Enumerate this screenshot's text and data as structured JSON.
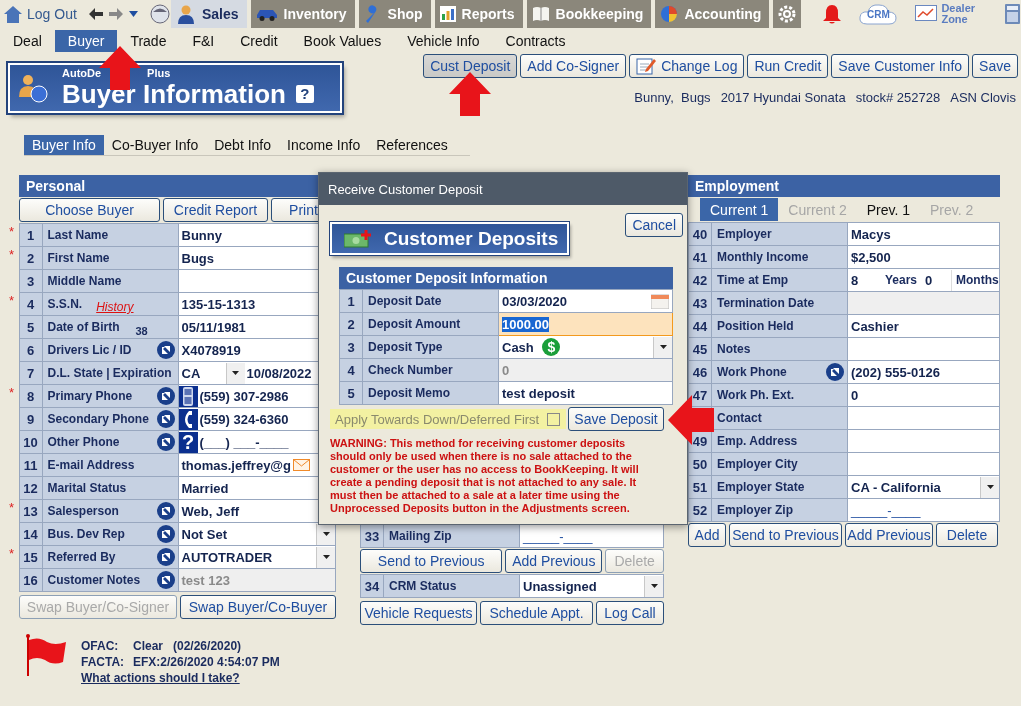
{
  "top_nav": {
    "logout": "Log Out",
    "modules": [
      {
        "label": "Sales",
        "selected": true
      },
      {
        "label": "Inventory",
        "selected": false
      },
      {
        "label": "Shop",
        "selected": false
      },
      {
        "label": "Reports",
        "selected": false
      },
      {
        "label": "Bookkeeping",
        "selected": false
      },
      {
        "label": "Accounting",
        "selected": false
      }
    ],
    "crm": "CRM",
    "dealer_zone": "Dealer Zone"
  },
  "menu": [
    {
      "label": "Deal",
      "selected": false
    },
    {
      "label": "Buyer",
      "selected": true
    },
    {
      "label": "Trade",
      "selected": false
    },
    {
      "label": "F&I",
      "selected": false
    },
    {
      "label": "Credit",
      "selected": false
    },
    {
      "label": "Book Values",
      "selected": false
    },
    {
      "label": "Vehicle Info",
      "selected": false
    },
    {
      "label": "Contracts",
      "selected": false
    }
  ],
  "header": {
    "brand_parts": [
      "AutoDe",
      "Plus"
    ],
    "title": "Buyer Information",
    "help": "?"
  },
  "actions": [
    {
      "label": "Cust Deposit",
      "pressed": true
    },
    {
      "label": "Add Co-Signer",
      "pressed": false
    },
    {
      "label": "Change Log",
      "pressed": false
    },
    {
      "label": "Run Credit",
      "pressed": false
    },
    {
      "label": "Save Customer Info",
      "pressed": false
    },
    {
      "label": "Save",
      "pressed": false
    }
  ],
  "customer_line": [
    "Bunny,  Bugs",
    "2017 Hyundai Sonata",
    "stock# 252728",
    "ASN Clovis"
  ],
  "subtabs": [
    {
      "label": "Buyer Info",
      "selected": true
    },
    {
      "label": "Co-Buyer Info",
      "selected": false
    },
    {
      "label": "Debt Info",
      "selected": false
    },
    {
      "label": "Income Info",
      "selected": false
    },
    {
      "label": "References",
      "selected": false
    }
  ],
  "personal": {
    "title": "Personal",
    "required_mark": "*",
    "buttons": [
      {
        "label": "Choose Buyer",
        "disabled": false
      },
      {
        "label": "Credit Report",
        "disabled": false
      },
      {
        "label": "Print",
        "disabled": false
      }
    ],
    "rows": [
      {
        "num": "1",
        "label": "Last Name",
        "value": "Bunny",
        "kind": "text",
        "required": true,
        "action": false
      },
      {
        "num": "2",
        "label": "First Name",
        "value": "Bugs",
        "kind": "text",
        "required": true,
        "action": false
      },
      {
        "num": "3",
        "label": "Middle Name",
        "kind": "text",
        "required": false,
        "action": false
      },
      {
        "num": "4",
        "label": "S.S.N.",
        "link": "History",
        "value": "135-15-1313",
        "kind": "text",
        "required": true,
        "action": false
      },
      {
        "num": "5",
        "label": "Date of Birth",
        "note": "38",
        "value": "05/11/1981",
        "kind": "text",
        "required": false,
        "action": false
      },
      {
        "num": "6",
        "label": "Drivers Lic / ID",
        "value": "X4078919",
        "kind": "text",
        "required": false,
        "action": true
      },
      {
        "num": "7",
        "label": "D.L. State | Expiration",
        "value": "CA",
        "value2": "10/08/2022",
        "kind": "state_date",
        "required": false,
        "action": false
      },
      {
        "num": "8",
        "label": "Primary Phone",
        "value": "(559) 307-2986",
        "kind": "phone",
        "required": true,
        "action": true
      },
      {
        "num": "9",
        "label": "Secondary Phone",
        "value": "(559) 324-6360",
        "kind": "phone",
        "required": false,
        "action": true
      },
      {
        "num": "10",
        "label": "Other Phone",
        "value": "(___) ___-____",
        "kind": "phone",
        "phone_glyph": "?",
        "required": false,
        "action": true
      },
      {
        "num": "11",
        "label": "E-mail Address",
        "value": "thomas.jeffrey@g",
        "kind": "email",
        "required": false,
        "action": false
      },
      {
        "num": "12",
        "label": "Marital Status",
        "value": "Married",
        "kind": "text",
        "required": false,
        "action": false
      },
      {
        "num": "13",
        "label": "Salesperson",
        "value": "Web, Jeff",
        "kind": "text",
        "required": true,
        "action": true
      },
      {
        "num": "14",
        "label": "Bus. Dev Rep",
        "value": "Not Set",
        "kind": "select",
        "required": false,
        "action": true
      },
      {
        "num": "15",
        "label": "Referred By",
        "value": "AUTOTRADER",
        "kind": "select",
        "required": true,
        "action": true
      },
      {
        "num": "16",
        "label": "Customer Notes",
        "value": "test 123",
        "kind": "readonly",
        "required": false,
        "action": true
      }
    ],
    "bottom_buttons": [
      {
        "label": "Swap Buyer/Co-Signer",
        "disabled": true
      },
      {
        "label": "Swap Buyer/Co-Buyer",
        "disabled": false
      }
    ]
  },
  "ofac": {
    "rows": [
      {
        "label": "OFAC:",
        "value": "Clear   (02/26/2020)"
      },
      {
        "label": "FACTA:",
        "value": "EFX:2/26/2020 4:54:07 PM"
      }
    ],
    "link": "What actions should I take?"
  },
  "middle": {
    "zip_row": {
      "num": "33",
      "label": "Mailing Zip",
      "value": "_____-____",
      "kind": "zip"
    },
    "buttons": [
      {
        "label": "Send to Previous",
        "disabled": false
      },
      {
        "label": "Add Previous",
        "disabled": false
      },
      {
        "label": "Delete",
        "disabled": true
      }
    ],
    "crm_row": {
      "num": "34",
      "label": "CRM Status",
      "value": "Unassigned",
      "kind": "select"
    },
    "buttons2": [
      {
        "label": "Vehicle Requests",
        "disabled": false
      },
      {
        "label": "Schedule Appt.",
        "disabled": false
      },
      {
        "label": "Log Call",
        "disabled": false
      }
    ]
  },
  "employment": {
    "title": "Employment",
    "tabs": [
      {
        "label": "Current 1",
        "selected": true,
        "disabled": false
      },
      {
        "label": "Current 2",
        "selected": false,
        "disabled": true
      },
      {
        "label": "Prev. 1",
        "selected": false,
        "disabled": false
      },
      {
        "label": "Prev. 2",
        "selected": false,
        "disabled": true
      }
    ],
    "rows": [
      {
        "num": "40",
        "label": "Employer",
        "value": "Macys",
        "kind": "text",
        "action": false
      },
      {
        "num": "41",
        "label": "Monthly Income",
        "value": "$2,500",
        "kind": "text",
        "action": false
      },
      {
        "num": "42",
        "label": "Time at Emp",
        "value": "8",
        "unit": "Years",
        "value2": "0",
        "unit2": "Months",
        "kind": "time",
        "action": false
      },
      {
        "num": "43",
        "label": "Termination Date",
        "kind": "readonly",
        "action": false
      },
      {
        "num": "44",
        "label": "Position Held",
        "value": "Cashier",
        "kind": "text",
        "action": false
      },
      {
        "num": "45",
        "label": "Notes",
        "kind": "text",
        "action": false
      },
      {
        "num": "46",
        "label": "Work Phone",
        "value": "(202) 555-0126",
        "kind": "text",
        "action": true
      },
      {
        "num": "47",
        "label": "Work Ph. Ext.",
        "value": "0",
        "kind": "text",
        "action": false
      },
      {
        "label": "Contact",
        "kind": "text",
        "action": false
      },
      {
        "num": "49",
        "label": "Emp. Address",
        "kind": "text",
        "action": false
      },
      {
        "num": "50",
        "label": "Employer City",
        "kind": "text",
        "action": false
      },
      {
        "num": "51",
        "label": "Employer State",
        "value": "CA - California",
        "kind": "select",
        "action": false
      },
      {
        "num": "52",
        "label": "Employer Zip",
        "value": "_____-____",
        "kind": "zip",
        "action": false
      }
    ],
    "buttons": [
      {
        "label": "Add",
        "disabled": false
      },
      {
        "label": "Send to Previous",
        "disabled": false
      },
      {
        "label": "Add Previous",
        "disabled": false
      },
      {
        "label": "Delete",
        "disabled": false
      }
    ]
  },
  "dialog": {
    "title": "Receive Customer Deposit",
    "banner": "Customer Deposits",
    "cancel": "Cancel",
    "section": "Customer Deposit Information",
    "rows": [
      {
        "num": "1",
        "label": "Deposit Date",
        "value": "03/03/2020",
        "kind": "date",
        "focused": false
      },
      {
        "num": "2",
        "label": "Deposit Amount",
        "value": "1000.00",
        "kind": "text",
        "focused": true
      },
      {
        "num": "3",
        "label": "Deposit Type",
        "value": "Cash",
        "kind": "select",
        "icon_glyph": "$",
        "focused": false
      },
      {
        "num": "4",
        "label": "Check Number",
        "value": "0",
        "kind": "readonly",
        "focused": false
      },
      {
        "num": "5",
        "label": "Deposit Memo",
        "value": "test deposit",
        "kind": "text",
        "focused": false
      }
    ],
    "apply": {
      "label": "Apply Towards Down/Deferred First",
      "checked": false
    },
    "save": "Save Deposit",
    "warning": "WARNING: This method for receiving customer deposits should only be used when there is no sale attached to the customer or the user has no access to BookKeeping. It will create a pending deposit that is not attached to any sale. It must then be attached to a sale at a later time using the Unprocessed Deposits button in the Adjustments screen."
  },
  "annotations": [
    {
      "kind": "uparrow"
    },
    {
      "kind": "uparrow"
    },
    {
      "kind": "leftarrow"
    }
  ]
}
